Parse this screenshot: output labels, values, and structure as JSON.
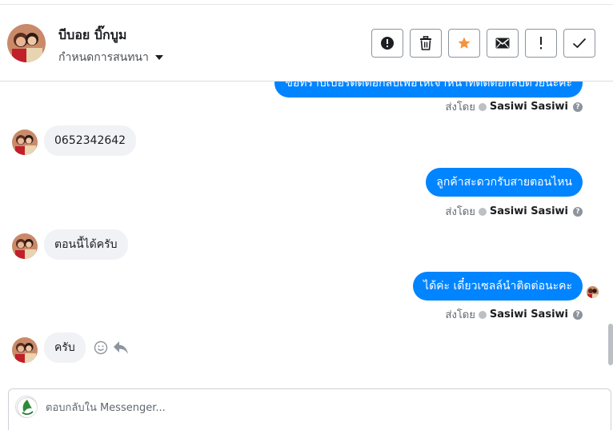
{
  "header": {
    "contact_name": "บีบอย บิ๊กบูม",
    "assign_label": "กำหนดการสนทนา"
  },
  "actions": [
    {
      "name": "spam-button",
      "icon": "alert-circle-icon"
    },
    {
      "name": "delete-button",
      "icon": "trash-icon"
    },
    {
      "name": "star-button",
      "icon": "star-icon",
      "color": "#f7923b"
    },
    {
      "name": "mark-unread-button",
      "icon": "envelope-icon"
    },
    {
      "name": "follow-up-button",
      "icon": "exclamation-icon"
    },
    {
      "name": "mark-done-button",
      "icon": "checkmark-icon"
    }
  ],
  "thread": {
    "sent_by_prefix": "ส่งโดย",
    "agent_name": "Sasiwi Sasiwi",
    "messages": [
      {
        "direction": "out",
        "text": "ขอทราบเบอร์ติดต่อกลับเพื่อให้เจ้าหน้าที่ติดต่อกลับด้วยนะคะ"
      },
      {
        "direction": "in",
        "text": "0652342642"
      },
      {
        "direction": "out",
        "text": "ลูกค้าสะดวกรับสายตอนไหน"
      },
      {
        "direction": "in",
        "text": "ตอนนี้ได้ครับ"
      },
      {
        "direction": "out",
        "text": "ได้ค่ะ เดี๋ยวเซลล์นำติดต่อนะคะ"
      },
      {
        "direction": "in",
        "text": "ครับ"
      }
    ]
  },
  "reply": {
    "placeholder": "ตอบกลับใน Messenger..."
  },
  "colors": {
    "outgoing_bubble": "#0084ff",
    "incoming_bubble": "#f0f2f5",
    "star": "#f7923b"
  }
}
